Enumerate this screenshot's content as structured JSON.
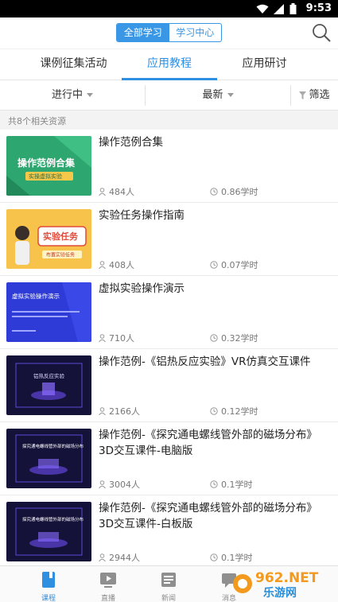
{
  "status_bar": {
    "time": "9:53"
  },
  "header": {
    "segments": [
      "全部学习",
      "学习中心"
    ],
    "active_segment": 0,
    "search_icon": "search-icon"
  },
  "tabs": [
    "课例征集活动",
    "应用教程",
    "应用研讨"
  ],
  "active_tab": 1,
  "filters": {
    "status": "进行中",
    "sort": "最新",
    "filter": "筛选"
  },
  "result_count": "共8个相关资源",
  "items": [
    {
      "title": "操作范例合集",
      "people": "484人",
      "hours": "0.86学时",
      "thumb_text": "操作范例合集",
      "thumb_sub": "实操虚拟实验"
    },
    {
      "title": "实验任务操作指南",
      "people": "408人",
      "hours": "0.07学时",
      "thumb_text": "实验任务",
      "thumb_sub": "布置实验任务"
    },
    {
      "title": "虚拟实验操作演示",
      "people": "710人",
      "hours": "0.32学时",
      "thumb_text": "虚拟实验操作演示",
      "thumb_sub": ""
    },
    {
      "title": "操作范例-《铝热反应实验》VR仿真交互课件",
      "people": "2166人",
      "hours": "0.12学时",
      "thumb_text": "铝热反应实验",
      "thumb_sub": ""
    },
    {
      "title": "操作范例-《探究通电螺线管外部的磁场分布》3D交互课件-电脑版",
      "people": "3004人",
      "hours": "0.1学时",
      "thumb_text": "探究通电螺线管外部的磁场分布",
      "thumb_sub": ""
    },
    {
      "title": "操作范例-《探究通电螺线管外部的磁场分布》3D交互课件-白板版",
      "people": "2944人",
      "hours": "0.1学时",
      "thumb_text": "探究通电螺线管外部的磁场分布",
      "thumb_sub": ""
    }
  ],
  "bottom_nav": [
    {
      "label": "课程",
      "icon": "book-icon",
      "active": true
    },
    {
      "label": "直播",
      "icon": "live-icon",
      "active": false
    },
    {
      "label": "新闻",
      "icon": "news-icon",
      "active": false
    },
    {
      "label": "消息",
      "icon": "message-icon",
      "active": false
    }
  ],
  "watermark": {
    "top": "962.NET",
    "bottom": "乐游网"
  },
  "colors": {
    "accent": "#2f8fe0",
    "segment": "#3a97e6"
  }
}
